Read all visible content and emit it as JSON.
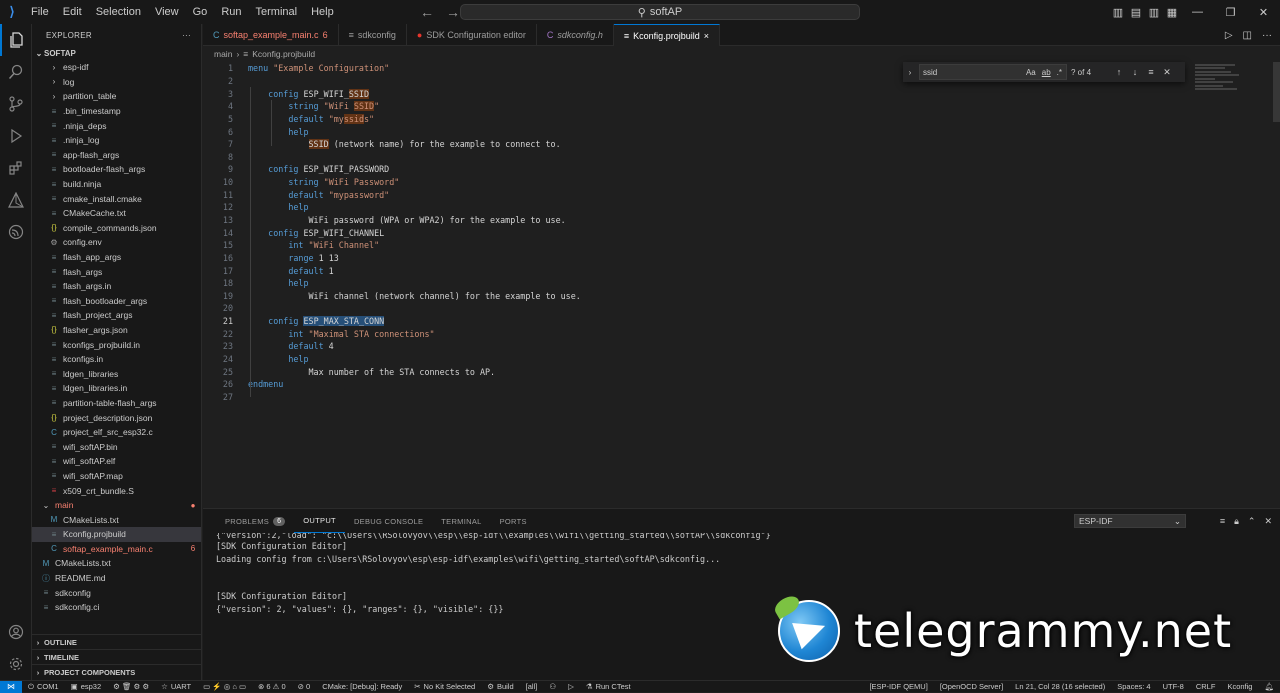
{
  "titlebar": {
    "menu": [
      "File",
      "Edit",
      "Selection",
      "View",
      "Go",
      "Run",
      "Terminal",
      "Help"
    ],
    "search_text": "softAP"
  },
  "sidebar": {
    "header": "EXPLORER",
    "root": "SOFTAP",
    "items": [
      {
        "label": "esp-idf",
        "kind": "folder",
        "icon": "chevron-right",
        "indent": 1
      },
      {
        "label": "log",
        "kind": "folder",
        "icon": "chevron-right",
        "indent": 1
      },
      {
        "label": "partition_table",
        "kind": "folder",
        "icon": "chevron-right",
        "indent": 1
      },
      {
        "label": ".bin_timestamp",
        "kind": "file",
        "icon": "",
        "indent": 1
      },
      {
        "label": ".ninja_deps",
        "kind": "file",
        "icon": "",
        "indent": 1
      },
      {
        "label": ".ninja_log",
        "kind": "file",
        "icon": "",
        "indent": 1
      },
      {
        "label": "app-flash_args",
        "kind": "file",
        "icon": "",
        "indent": 1
      },
      {
        "label": "bootloader-flash_args",
        "kind": "file",
        "icon": "",
        "indent": 1
      },
      {
        "label": "build.ninja",
        "kind": "file",
        "icon": "",
        "indent": 1
      },
      {
        "label": "cmake_install.cmake",
        "kind": "file",
        "icon": "",
        "indent": 1
      },
      {
        "label": "CMakeCache.txt",
        "kind": "file",
        "icon": "",
        "indent": 1
      },
      {
        "label": "compile_commands.json",
        "kind": "file",
        "icon": "{}",
        "indent": 1
      },
      {
        "label": "config.env",
        "kind": "file",
        "icon": "⚙",
        "indent": 1
      },
      {
        "label": "flash_app_args",
        "kind": "file",
        "icon": "",
        "indent": 1
      },
      {
        "label": "flash_args",
        "kind": "file",
        "icon": "",
        "indent": 1
      },
      {
        "label": "flash_args.in",
        "kind": "file",
        "icon": "",
        "indent": 1
      },
      {
        "label": "flash_bootloader_args",
        "kind": "file",
        "icon": "",
        "indent": 1
      },
      {
        "label": "flash_project_args",
        "kind": "file",
        "icon": "",
        "indent": 1
      },
      {
        "label": "flasher_args.json",
        "kind": "file",
        "icon": "{}",
        "indent": 1
      },
      {
        "label": "kconfigs_projbuild.in",
        "kind": "file",
        "icon": "",
        "indent": 1
      },
      {
        "label": "kconfigs.in",
        "kind": "file",
        "icon": "",
        "indent": 1
      },
      {
        "label": "ldgen_libraries",
        "kind": "file",
        "icon": "",
        "indent": 1
      },
      {
        "label": "ldgen_libraries.in",
        "kind": "file",
        "icon": "",
        "indent": 1
      },
      {
        "label": "partition-table-flash_args",
        "kind": "file",
        "icon": "",
        "indent": 1
      },
      {
        "label": "project_description.json",
        "kind": "file",
        "icon": "{}",
        "indent": 1
      },
      {
        "label": "project_elf_src_esp32.c",
        "kind": "file",
        "icon": "C",
        "indent": 1
      },
      {
        "label": "wifi_softAP.bin",
        "kind": "file",
        "icon": "",
        "indent": 1
      },
      {
        "label": "wifi_softAP.elf",
        "kind": "file",
        "icon": "",
        "indent": 1
      },
      {
        "label": "wifi_softAP.map",
        "kind": "file",
        "icon": "",
        "indent": 1
      },
      {
        "label": "x509_crt_bundle.S",
        "kind": "file",
        "icon": "ASM",
        "indent": 1
      },
      {
        "label": "main",
        "kind": "folder-open",
        "icon": "chevron-down",
        "indent": 0,
        "error": true,
        "dot": "●"
      },
      {
        "label": "CMakeLists.txt",
        "kind": "file",
        "icon": "M",
        "indent": 1
      },
      {
        "label": "Kconfig.projbuild",
        "kind": "file",
        "icon": "",
        "indent": 1,
        "selected": true
      },
      {
        "label": "softap_example_main.c",
        "kind": "file",
        "icon": "C",
        "indent": 1,
        "error": true,
        "badge": "6"
      },
      {
        "label": "CMakeLists.txt",
        "kind": "file",
        "icon": "M",
        "indent": 0
      },
      {
        "label": "README.md",
        "kind": "file",
        "icon": "ⓘ",
        "indent": 0
      },
      {
        "label": "sdkconfig",
        "kind": "file",
        "icon": "",
        "indent": 0
      },
      {
        "label": "sdkconfig.ci",
        "kind": "file",
        "icon": "",
        "indent": 0
      }
    ],
    "bottom_sections": [
      "OUTLINE",
      "TIMELINE",
      "PROJECT COMPONENTS"
    ]
  },
  "tabs": [
    {
      "label": "softap_example_main.c",
      "icon": "C",
      "badge": "6",
      "error": true
    },
    {
      "label": "sdkconfig",
      "icon": ""
    },
    {
      "label": "SDK Configuration editor",
      "icon": "●"
    },
    {
      "label": "sdkconfig.h",
      "icon": "C",
      "italic": true
    },
    {
      "label": "Kconfig.projbuild",
      "icon": "",
      "active": true,
      "close": "×"
    }
  ],
  "breadcrumb": [
    "main",
    "›",
    "Kconfig.projbuild"
  ],
  "find": {
    "value": "ssid",
    "options": [
      "Aa",
      "ab",
      ".*"
    ],
    "count": "? of 4"
  },
  "editor": {
    "current_line": 21,
    "lines": [
      [
        {
          "t": "menu",
          "c": "kw"
        },
        {
          "t": " "
        },
        {
          "t": "\"Example Configuration\"",
          "c": "str"
        }
      ],
      [],
      [
        {
          "t": "    "
        },
        {
          "t": "config",
          "c": "kw"
        },
        {
          "t": " ESP_WIFI_"
        },
        {
          "t": "SSID",
          "c": "hl"
        }
      ],
      [
        {
          "t": "        "
        },
        {
          "t": "string",
          "c": "kw"
        },
        {
          "t": " "
        },
        {
          "t": "\"WiFi ",
          "c": "str"
        },
        {
          "t": "SSID",
          "c": "str hl"
        },
        {
          "t": "\"",
          "c": "str"
        }
      ],
      [
        {
          "t": "        "
        },
        {
          "t": "default",
          "c": "kw"
        },
        {
          "t": " "
        },
        {
          "t": "\"my",
          "c": "str"
        },
        {
          "t": "ssid",
          "c": "str hl"
        },
        {
          "t": "s\"",
          "c": "str"
        }
      ],
      [
        {
          "t": "        "
        },
        {
          "t": "help",
          "c": "kw"
        }
      ],
      [
        {
          "t": "            "
        },
        {
          "t": "SSID",
          "c": "hl"
        },
        {
          "t": " (network name) for the example to connect to."
        }
      ],
      [],
      [
        {
          "t": "    "
        },
        {
          "t": "config",
          "c": "kw"
        },
        {
          "t": " ESP_WIFI_PASSWORD"
        }
      ],
      [
        {
          "t": "        "
        },
        {
          "t": "string",
          "c": "kw"
        },
        {
          "t": " "
        },
        {
          "t": "\"WiFi Password\"",
          "c": "str"
        }
      ],
      [
        {
          "t": "        "
        },
        {
          "t": "default",
          "c": "kw"
        },
        {
          "t": " "
        },
        {
          "t": "\"mypassword\"",
          "c": "str"
        }
      ],
      [
        {
          "t": "        "
        },
        {
          "t": "help",
          "c": "kw"
        }
      ],
      [
        {
          "t": "            WiFi password (WPA or WPA2) for the example to use."
        }
      ],
      [
        {
          "t": "    "
        },
        {
          "t": "config",
          "c": "kw"
        },
        {
          "t": " ESP_WIFI_CHANNEL"
        }
      ],
      [
        {
          "t": "        "
        },
        {
          "t": "int",
          "c": "kw"
        },
        {
          "t": " "
        },
        {
          "t": "\"WiFi Channel\"",
          "c": "str"
        }
      ],
      [
        {
          "t": "        "
        },
        {
          "t": "range",
          "c": "kw"
        },
        {
          "t": " 1 13"
        }
      ],
      [
        {
          "t": "        "
        },
        {
          "t": "default",
          "c": "kw"
        },
        {
          "t": " 1"
        }
      ],
      [
        {
          "t": "        "
        },
        {
          "t": "help",
          "c": "kw"
        }
      ],
      [
        {
          "t": "            WiFi channel (network channel) for the example to use."
        }
      ],
      [],
      [
        {
          "t": "    "
        },
        {
          "t": "config",
          "c": "kw"
        },
        {
          "t": " "
        },
        {
          "t": "ESP_MAX_STA_CONN",
          "c": "sel-hl"
        }
      ],
      [
        {
          "t": "        "
        },
        {
          "t": "int",
          "c": "kw"
        },
        {
          "t": " "
        },
        {
          "t": "\"Maximal STA connections\"",
          "c": "str"
        }
      ],
      [
        {
          "t": "        "
        },
        {
          "t": "default",
          "c": "kw"
        },
        {
          "t": " 4"
        }
      ],
      [
        {
          "t": "        "
        },
        {
          "t": "help",
          "c": "kw"
        }
      ],
      [
        {
          "t": "            Max number of the STA connects to AP."
        }
      ],
      [
        {
          "t": "endmenu",
          "c": "kw"
        }
      ],
      []
    ]
  },
  "panel": {
    "tabs": [
      {
        "label": "PROBLEMS",
        "badge": "6"
      },
      {
        "label": "OUTPUT",
        "active": true
      },
      {
        "label": "DEBUG CONSOLE"
      },
      {
        "label": "TERMINAL"
      },
      {
        "label": "PORTS"
      }
    ],
    "output_channel": "ESP-IDF",
    "output_lines": [
      "{\"version\":2,\"load\": \"c:\\\\Users\\\\RSolovyov\\\\esp\\\\esp-idf\\\\examples\\\\wifi\\\\getting_started\\\\softAP\\\\sdkconfig\"}",
      "[SDK Configuration Editor]",
      "Loading config from c:\\Users\\RSolovyov\\esp\\esp-idf\\examples\\wifi\\getting_started\\softAP\\sdkconfig...",
      "",
      "",
      "[SDK Configuration Editor]",
      "{\"version\": 2, \"values\": {}, \"ranges\": {}, \"visible\": {}}"
    ]
  },
  "watermark": {
    "text": "telegrammy.net"
  },
  "statusbar": {
    "left": [
      "COM1",
      "esp32",
      "UART",
      "⊗ 6 ⚠ 0",
      "⊘ 0",
      "CMake: [Debug]: Ready",
      "No Kit Selected",
      "Build",
      "[all]",
      "Run CTest"
    ],
    "right": [
      "[ESP-IDF QEMU]",
      "[OpenOCD Server]",
      "Ln 21, Col 28 (16 selected)",
      "Spaces: 4",
      "UTF-8",
      "CRLF",
      "Kconfig"
    ]
  }
}
